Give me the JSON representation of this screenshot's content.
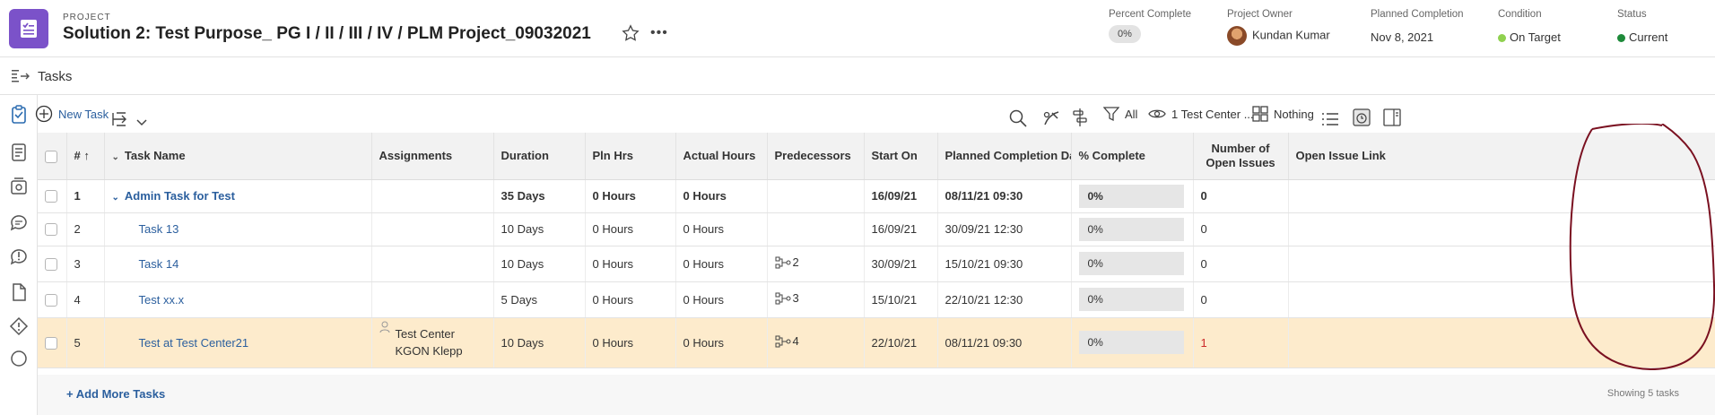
{
  "project": {
    "kicker": "PROJECT",
    "title": "Solution 2: Test Purpose_ PG I / II / III / IV / PLM Project_09032021"
  },
  "meta": {
    "percent_complete": {
      "label": "Percent Complete",
      "value": "0%"
    },
    "owner": {
      "label": "Project Owner",
      "value": "Kundan Kumar"
    },
    "planned_completion": {
      "label": "Planned Completion",
      "value": "Nov 8, 2021"
    },
    "condition": {
      "label": "Condition",
      "value": "On Target",
      "color": "#8fd14f"
    },
    "status": {
      "label": "Status",
      "value": "Current",
      "color": "#1e8a3a"
    }
  },
  "tasks_bar": {
    "label": "Tasks"
  },
  "toolbar": {
    "new_task": "New Task",
    "filter": "All",
    "view": "1 Test Center ...",
    "grouping": "Nothing"
  },
  "columns": {
    "num": "#",
    "task_name": "Task Name",
    "assignments": "Assignments",
    "duration": "Duration",
    "pln_hrs": "Pln Hrs",
    "actual_hours": "Actual Hours",
    "predecessors": "Predecessors",
    "start_on": "Start On",
    "planned_completion_date": "Planned Completion Date",
    "pct_complete": "% Complete",
    "open_issues": "Number of Open Issues",
    "open_issue_link": "Open Issue Link"
  },
  "rows": [
    {
      "num": "1",
      "name": "Admin Task for Test",
      "assignments": "",
      "duration": "35 Days",
      "pln_hrs": "0 Hours",
      "actual_hours": "0 Hours",
      "predecessors": "",
      "start_on": "16/09/21",
      "planned_completion": "08/11/21 09:30",
      "pct": "0%",
      "open_issues": "0"
    },
    {
      "num": "2",
      "name": "Task 13",
      "assignments": "",
      "duration": "10 Days",
      "pln_hrs": "0 Hours",
      "actual_hours": "0 Hours",
      "predecessors": "",
      "start_on": "16/09/21",
      "planned_completion": "30/09/21 12:30",
      "pct": "0%",
      "open_issues": "0"
    },
    {
      "num": "3",
      "name": "Task 14",
      "assignments": "",
      "duration": "10 Days",
      "pln_hrs": "0 Hours",
      "actual_hours": "0 Hours",
      "predecessors": "2",
      "start_on": "30/09/21",
      "planned_completion": "15/10/21 09:30",
      "pct": "0%",
      "open_issues": "0"
    },
    {
      "num": "4",
      "name": "Test xx.x",
      "assignments": "",
      "duration": "5 Days",
      "pln_hrs": "0 Hours",
      "actual_hours": "0 Hours",
      "predecessors": "3",
      "start_on": "15/10/21",
      "planned_completion": "22/10/21 12:30",
      "pct": "0%",
      "open_issues": "0"
    },
    {
      "num": "5",
      "name": "Test at Test Center21",
      "assignments": "Test Center KGON Klepp",
      "duration": "10 Days",
      "pln_hrs": "0 Hours",
      "actual_hours": "0 Hours",
      "predecessors": "4",
      "start_on": "22/10/21",
      "planned_completion": "08/11/21 09:30",
      "pct": "0%",
      "open_issues": "1"
    }
  ],
  "footer": {
    "add_more": "+ Add More Tasks",
    "showing": "Showing 5 tasks"
  }
}
